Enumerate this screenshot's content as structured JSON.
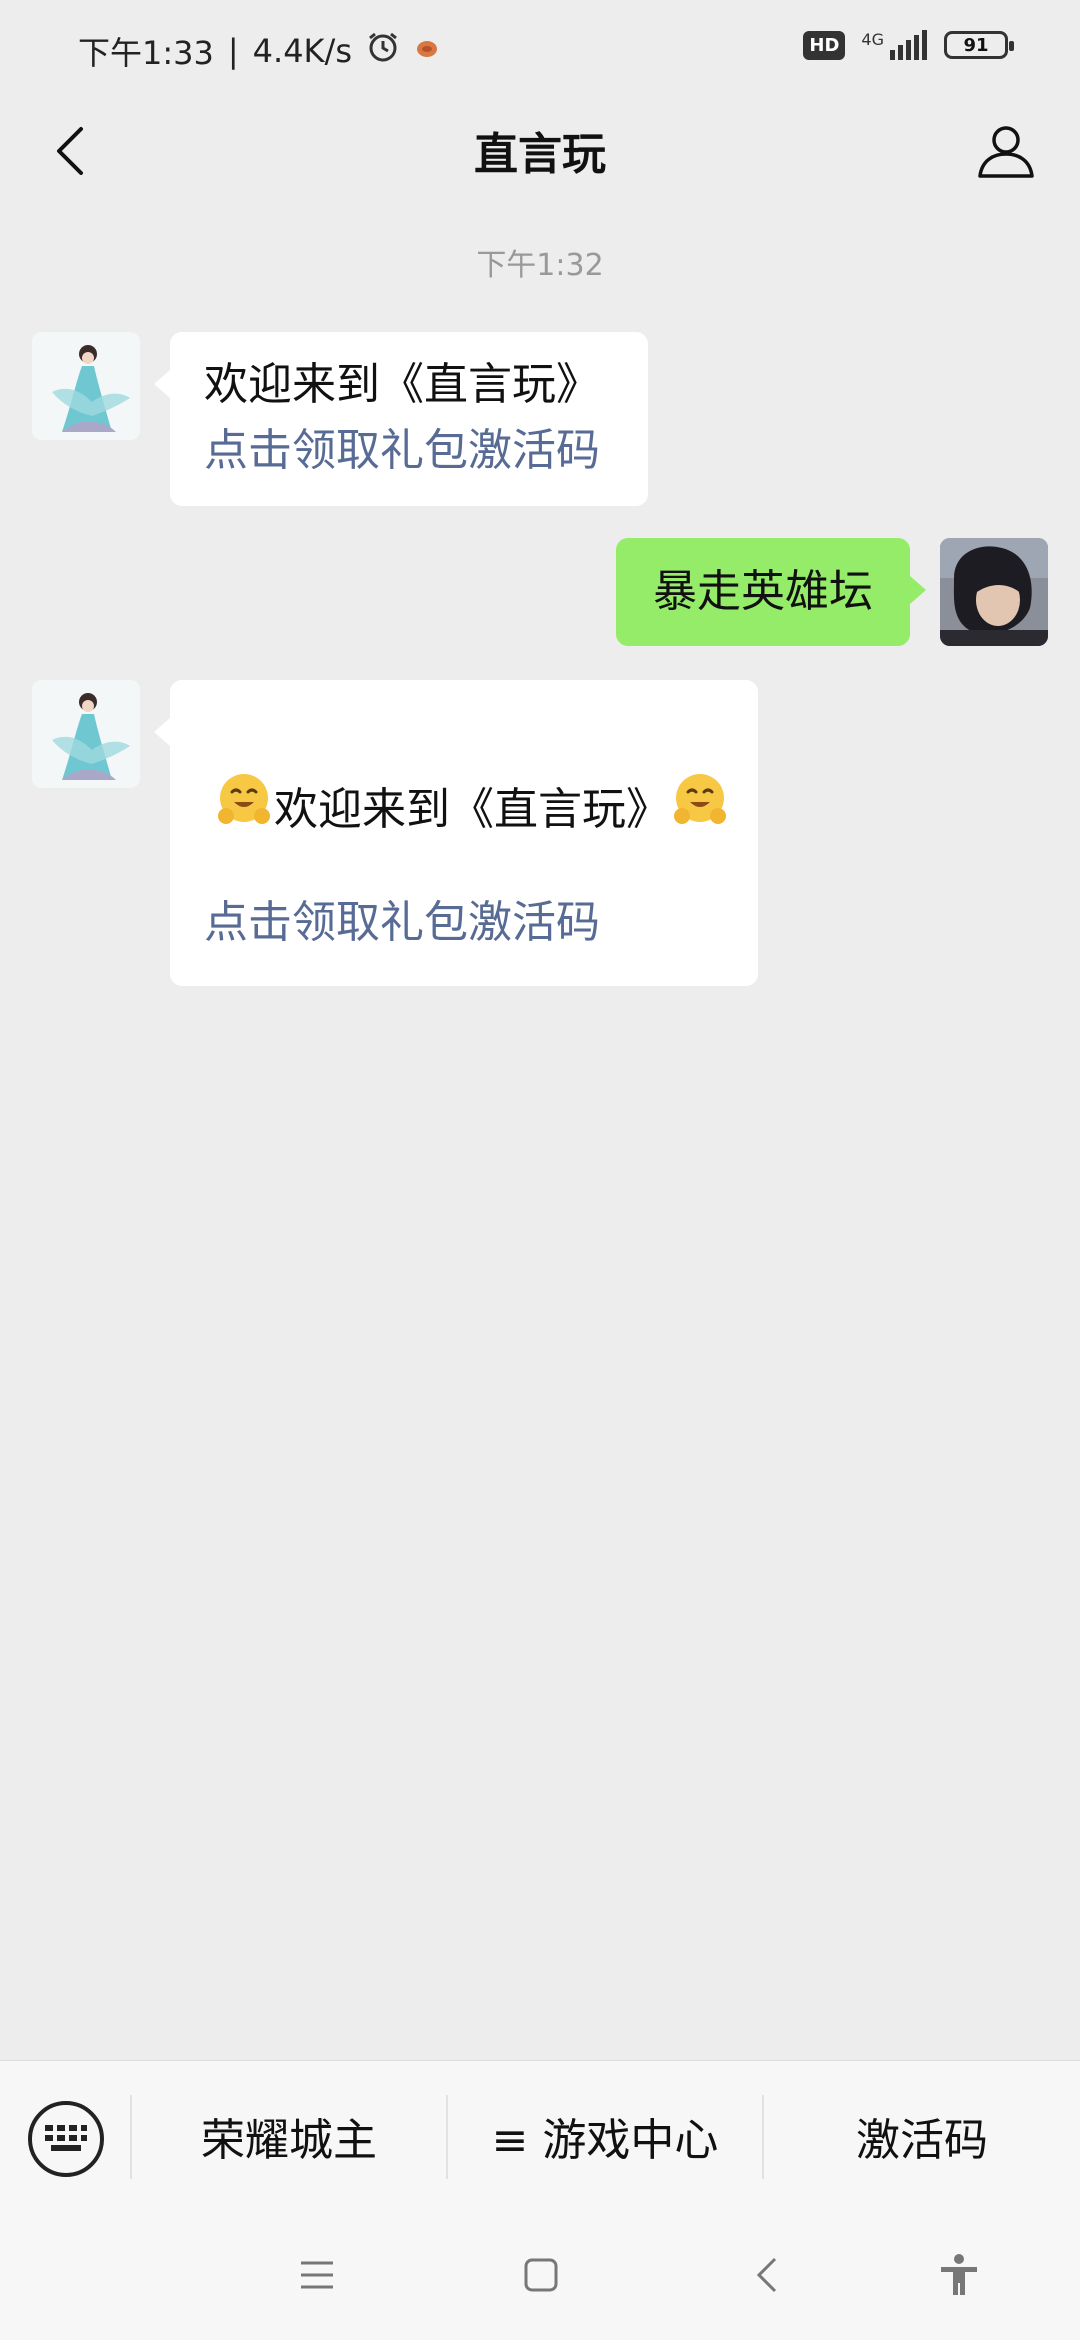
{
  "status_bar": {
    "time": "下午1:33",
    "speed": "4.4K/s",
    "hd": "HD",
    "network": "4G",
    "battery": "91"
  },
  "header": {
    "title": "直言玩"
  },
  "chat": {
    "timestamp": "下午1:32",
    "messages": [
      {
        "from": "bot",
        "line1": "欢迎来到《直言玩》",
        "link": "点击领取礼包激活码"
      },
      {
        "from": "me",
        "text": "暴走英雄坛"
      },
      {
        "from": "bot",
        "line1": "欢迎来到《直言玩》",
        "link": "点击领取礼包激活码"
      }
    ]
  },
  "menu": {
    "items": [
      "荣耀城主",
      "≡ 游戏中心",
      "激活码"
    ]
  },
  "icons": {
    "back": "chevron-left-icon",
    "profile": "person-icon",
    "keyboard": "keyboard-icon",
    "emoji": "hugging-face-emoji",
    "alarm": "alarm-icon"
  },
  "colors": {
    "background": "#ededed",
    "sent_bubble": "#95ec69",
    "link": "#576b95"
  }
}
